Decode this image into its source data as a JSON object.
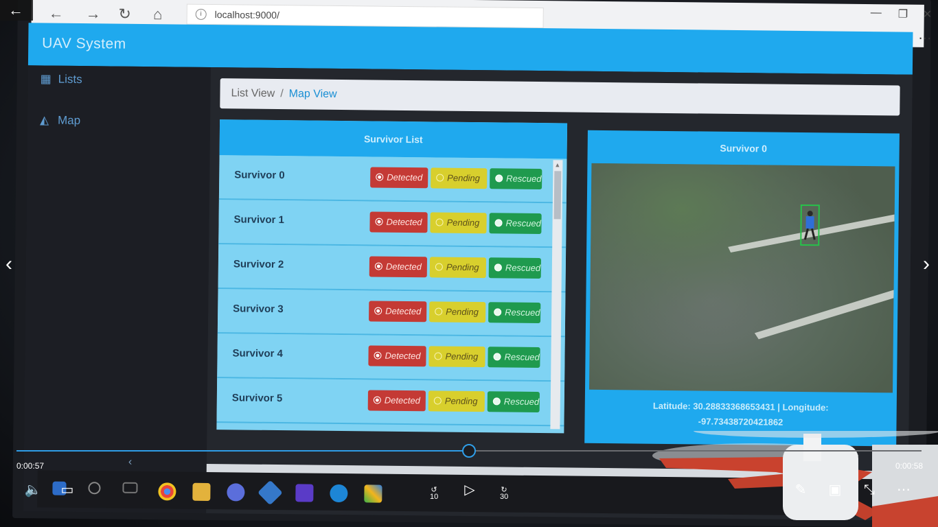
{
  "player": {
    "elapsed": "0:00:57",
    "duration": "0:00:58",
    "progress": 0.5
  },
  "browser": {
    "url": "localhost:9000/"
  },
  "app": {
    "title": "UAV System",
    "sidebar": [
      {
        "label": "Lists",
        "icon": "list-icon"
      },
      {
        "label": "Map",
        "icon": "area-chart-icon"
      }
    ],
    "breadcrumb": {
      "item1": "List View",
      "separator": "/",
      "item2": "Map View"
    },
    "survivor_list": {
      "title": "Survivor List",
      "status_labels": {
        "detected": "Detected",
        "pending": "Pending",
        "rescued": "Rescued"
      },
      "items": [
        {
          "name": "Survivor 0",
          "status": "Detected"
        },
        {
          "name": "Survivor 1",
          "status": "Detected"
        },
        {
          "name": "Survivor 2",
          "status": "Detected"
        },
        {
          "name": "Survivor 3",
          "status": "Detected"
        },
        {
          "name": "Survivor 4",
          "status": "Detected"
        },
        {
          "name": "Survivor 5",
          "status": "Detected"
        }
      ]
    },
    "detail": {
      "title": "Survivor 0",
      "coords": "Latitude: 30.28833368653431 | Longitude: -97.73438720421862"
    }
  },
  "colors": {
    "header_blue": "#1fa9ee",
    "detected_red": "#c43a35",
    "pending_yellow": "#d8cf2d",
    "rescued_green": "#1f9a4e",
    "player_accent": "#2f9ee8"
  }
}
